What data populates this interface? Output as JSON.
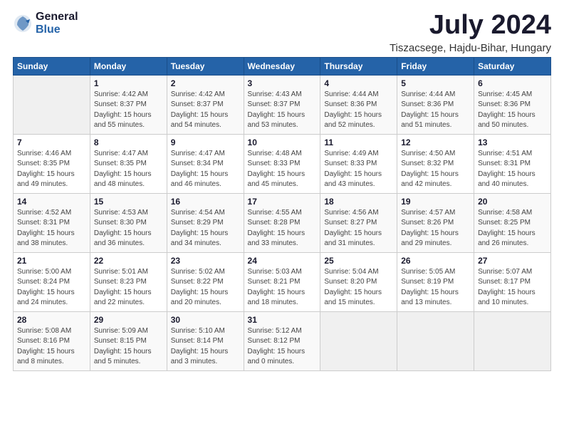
{
  "logo": {
    "general": "General",
    "blue": "Blue"
  },
  "header": {
    "month_year": "July 2024",
    "location": "Tiszacsege, Hajdu-Bihar, Hungary"
  },
  "columns": [
    "Sunday",
    "Monday",
    "Tuesday",
    "Wednesday",
    "Thursday",
    "Friday",
    "Saturday"
  ],
  "weeks": [
    [
      {
        "day": "",
        "info": ""
      },
      {
        "day": "1",
        "info": "Sunrise: 4:42 AM\nSunset: 8:37 PM\nDaylight: 15 hours\nand 55 minutes."
      },
      {
        "day": "2",
        "info": "Sunrise: 4:42 AM\nSunset: 8:37 PM\nDaylight: 15 hours\nand 54 minutes."
      },
      {
        "day": "3",
        "info": "Sunrise: 4:43 AM\nSunset: 8:37 PM\nDaylight: 15 hours\nand 53 minutes."
      },
      {
        "day": "4",
        "info": "Sunrise: 4:44 AM\nSunset: 8:36 PM\nDaylight: 15 hours\nand 52 minutes."
      },
      {
        "day": "5",
        "info": "Sunrise: 4:44 AM\nSunset: 8:36 PM\nDaylight: 15 hours\nand 51 minutes."
      },
      {
        "day": "6",
        "info": "Sunrise: 4:45 AM\nSunset: 8:36 PM\nDaylight: 15 hours\nand 50 minutes."
      }
    ],
    [
      {
        "day": "7",
        "info": "Sunrise: 4:46 AM\nSunset: 8:35 PM\nDaylight: 15 hours\nand 49 minutes."
      },
      {
        "day": "8",
        "info": "Sunrise: 4:47 AM\nSunset: 8:35 PM\nDaylight: 15 hours\nand 48 minutes."
      },
      {
        "day": "9",
        "info": "Sunrise: 4:47 AM\nSunset: 8:34 PM\nDaylight: 15 hours\nand 46 minutes."
      },
      {
        "day": "10",
        "info": "Sunrise: 4:48 AM\nSunset: 8:33 PM\nDaylight: 15 hours\nand 45 minutes."
      },
      {
        "day": "11",
        "info": "Sunrise: 4:49 AM\nSunset: 8:33 PM\nDaylight: 15 hours\nand 43 minutes."
      },
      {
        "day": "12",
        "info": "Sunrise: 4:50 AM\nSunset: 8:32 PM\nDaylight: 15 hours\nand 42 minutes."
      },
      {
        "day": "13",
        "info": "Sunrise: 4:51 AM\nSunset: 8:31 PM\nDaylight: 15 hours\nand 40 minutes."
      }
    ],
    [
      {
        "day": "14",
        "info": "Sunrise: 4:52 AM\nSunset: 8:31 PM\nDaylight: 15 hours\nand 38 minutes."
      },
      {
        "day": "15",
        "info": "Sunrise: 4:53 AM\nSunset: 8:30 PM\nDaylight: 15 hours\nand 36 minutes."
      },
      {
        "day": "16",
        "info": "Sunrise: 4:54 AM\nSunset: 8:29 PM\nDaylight: 15 hours\nand 34 minutes."
      },
      {
        "day": "17",
        "info": "Sunrise: 4:55 AM\nSunset: 8:28 PM\nDaylight: 15 hours\nand 33 minutes."
      },
      {
        "day": "18",
        "info": "Sunrise: 4:56 AM\nSunset: 8:27 PM\nDaylight: 15 hours\nand 31 minutes."
      },
      {
        "day": "19",
        "info": "Sunrise: 4:57 AM\nSunset: 8:26 PM\nDaylight: 15 hours\nand 29 minutes."
      },
      {
        "day": "20",
        "info": "Sunrise: 4:58 AM\nSunset: 8:25 PM\nDaylight: 15 hours\nand 26 minutes."
      }
    ],
    [
      {
        "day": "21",
        "info": "Sunrise: 5:00 AM\nSunset: 8:24 PM\nDaylight: 15 hours\nand 24 minutes."
      },
      {
        "day": "22",
        "info": "Sunrise: 5:01 AM\nSunset: 8:23 PM\nDaylight: 15 hours\nand 22 minutes."
      },
      {
        "day": "23",
        "info": "Sunrise: 5:02 AM\nSunset: 8:22 PM\nDaylight: 15 hours\nand 20 minutes."
      },
      {
        "day": "24",
        "info": "Sunrise: 5:03 AM\nSunset: 8:21 PM\nDaylight: 15 hours\nand 18 minutes."
      },
      {
        "day": "25",
        "info": "Sunrise: 5:04 AM\nSunset: 8:20 PM\nDaylight: 15 hours\nand 15 minutes."
      },
      {
        "day": "26",
        "info": "Sunrise: 5:05 AM\nSunset: 8:19 PM\nDaylight: 15 hours\nand 13 minutes."
      },
      {
        "day": "27",
        "info": "Sunrise: 5:07 AM\nSunset: 8:17 PM\nDaylight: 15 hours\nand 10 minutes."
      }
    ],
    [
      {
        "day": "28",
        "info": "Sunrise: 5:08 AM\nSunset: 8:16 PM\nDaylight: 15 hours\nand 8 minutes."
      },
      {
        "day": "29",
        "info": "Sunrise: 5:09 AM\nSunset: 8:15 PM\nDaylight: 15 hours\nand 5 minutes."
      },
      {
        "day": "30",
        "info": "Sunrise: 5:10 AM\nSunset: 8:14 PM\nDaylight: 15 hours\nand 3 minutes."
      },
      {
        "day": "31",
        "info": "Sunrise: 5:12 AM\nSunset: 8:12 PM\nDaylight: 15 hours\nand 0 minutes."
      },
      {
        "day": "",
        "info": ""
      },
      {
        "day": "",
        "info": ""
      },
      {
        "day": "",
        "info": ""
      }
    ]
  ]
}
